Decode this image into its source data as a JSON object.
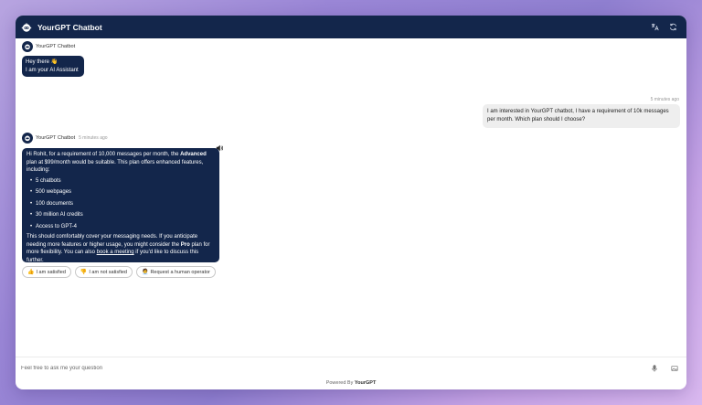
{
  "header": {
    "title": "YourGPT Chatbot",
    "icons": [
      "bot-logo",
      "translate-icon",
      "refresh-icon"
    ]
  },
  "messages": {
    "greeting": {
      "sender": "YourGPT Chatbot",
      "line1": "Hey there 👋",
      "line2": "I am your AI Assistant"
    },
    "user": {
      "time": "5 minutes ago",
      "line1": "I am interested in YourGPT chatbot, I have a requirement of 10k messages",
      "line2": "per month. Which plan should I choose?"
    },
    "reply": {
      "sender": "YourGPT Chatbot",
      "time": "5 minutes ago",
      "p1_a": "Hi Rohit, for a requirement of 10,000 messages per month, the ",
      "p1_bold": "Advanced",
      "p1_b": " plan at $99/month would be suitable. This plan offers enhanced features, including:",
      "features": [
        "5 chatbots",
        "500 webpages",
        "100 documents",
        "30 million AI credits",
        "Access to GPT-4"
      ],
      "p2_a": "This should comfortably cover your messaging needs. If you anticipate needing more features or higher usage, you might consider the ",
      "p2_bold": "Pro",
      "p2_b": " plan for more flexibility. You can also ",
      "p2_link": "book a meeting",
      "p2_c": " if you'd like to discuss this further."
    }
  },
  "chips": [
    {
      "emoji": "👍",
      "label": "I am satisfied"
    },
    {
      "emoji": "👎",
      "label": "I am not satisfied"
    },
    {
      "emoji": "🧑‍💼",
      "label": "Request a human operator"
    }
  ],
  "composer": {
    "placeholder": "Feel free to ask me your question",
    "icons": [
      "microphone-icon",
      "image-icon"
    ]
  },
  "footer": {
    "prefix": "Powered By ",
    "brand": "YourGPT"
  },
  "colors": {
    "primary": "#13264b",
    "user_bubble": "#eeeeee",
    "background_gradient": "purple"
  }
}
